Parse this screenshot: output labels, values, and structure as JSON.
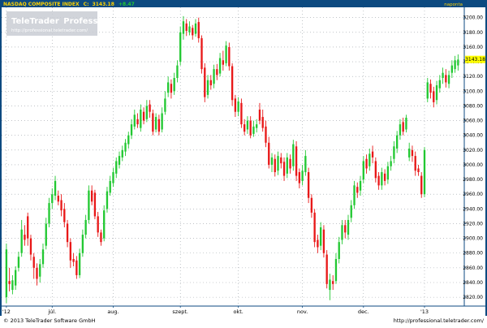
{
  "header": {
    "instrument": "NASDAQ COMPOSITE INDEX",
    "close_label": "C:",
    "close_value": "3143.18",
    "change": "+8.47",
    "interval": "napontа"
  },
  "watermark": {
    "brand_a": "TeleTrader",
    "brand_b": "Professional",
    "url": "http://professional.teletrader.com/"
  },
  "footer": {
    "copyright": "© 2013 TeleTrader Software GmbH",
    "url": "http://professional.teletrader.com/"
  },
  "colors": {
    "frame": "#0d4a80",
    "header_bg": "#0d4a80",
    "header_text": "#ffd200",
    "up": "#22c832",
    "down": "#e81818",
    "grid": "#9aa0a6",
    "price_tag_bg": "#ffff00"
  },
  "chart_data": {
    "type": "candlestick",
    "ylim": [
      2808,
      3214
    ],
    "yticks": [
      2820,
      2840,
      2860,
      2880,
      2900,
      2920,
      2940,
      2960,
      2980,
      3000,
      3020,
      3040,
      3060,
      3080,
      3100,
      3120,
      3140,
      3160,
      3180,
      3200
    ],
    "ytick_labels": [
      "2820.00",
      "2840.00",
      "2860.00",
      "2880.00",
      "2900.00",
      "2920.00",
      "2940.00",
      "2960.00",
      "2980.00",
      "3000.00",
      "3020.00",
      "3040.00",
      "3060.00",
      "3080.00",
      "3100.00",
      "3120.00",
      "3140.00",
      "3160.00",
      "3180.00",
      "3200.00"
    ],
    "last_price": 3143.18,
    "last_price_label": "3143.18",
    "x_count": 150,
    "xticks": [
      {
        "index": 0,
        "label": "'12"
      },
      {
        "index": 15,
        "label": "júl."
      },
      {
        "index": 35,
        "label": "aug."
      },
      {
        "index": 57,
        "label": "szept."
      },
      {
        "index": 76,
        "label": "okt."
      },
      {
        "index": 97,
        "label": "nov."
      },
      {
        "index": 117,
        "label": "dec."
      },
      {
        "index": 137,
        "label": "'13"
      }
    ],
    "candles": [
      {
        "o": 2820,
        "c": 2885,
        "h": 2893,
        "l": 2812
      },
      {
        "o": 2842,
        "c": 2838,
        "h": 2860,
        "l": 2828
      },
      {
        "o": 2830,
        "c": 2843,
        "h": 2850,
        "l": 2824
      },
      {
        "o": 2836,
        "c": 2857,
        "h": 2862,
        "l": 2830
      },
      {
        "o": 2860,
        "c": 2875,
        "h": 2882,
        "l": 2855
      },
      {
        "o": 2880,
        "c": 2912,
        "h": 2925,
        "l": 2875
      },
      {
        "o": 2905,
        "c": 2898,
        "h": 2918,
        "l": 2890
      },
      {
        "o": 2930,
        "c": 2900,
        "h": 2935,
        "l": 2890
      },
      {
        "o": 2900,
        "c": 2878,
        "h": 2905,
        "l": 2870
      },
      {
        "o": 2875,
        "c": 2860,
        "h": 2880,
        "l": 2845
      },
      {
        "o": 2860,
        "c": 2845,
        "h": 2866,
        "l": 2836
      },
      {
        "o": 2848,
        "c": 2865,
        "h": 2872,
        "l": 2840
      },
      {
        "o": 2865,
        "c": 2885,
        "h": 2893,
        "l": 2860
      },
      {
        "o": 2890,
        "c": 2920,
        "h": 2928,
        "l": 2885
      },
      {
        "o": 2920,
        "c": 2948,
        "h": 2955,
        "l": 2915
      },
      {
        "o": 2948,
        "c": 2960,
        "h": 2968,
        "l": 2940
      },
      {
        "o": 2958,
        "c": 2978,
        "h": 2985,
        "l": 2952
      },
      {
        "o": 2958,
        "c": 2950,
        "h": 2965,
        "l": 2945
      },
      {
        "o": 2952,
        "c": 2938,
        "h": 2960,
        "l": 2930
      },
      {
        "o": 2940,
        "c": 2922,
        "h": 2948,
        "l": 2915
      },
      {
        "o": 2920,
        "c": 2895,
        "h": 2925,
        "l": 2888
      },
      {
        "o": 2895,
        "c": 2870,
        "h": 2900,
        "l": 2860
      },
      {
        "o": 2872,
        "c": 2868,
        "h": 2880,
        "l": 2862
      },
      {
        "o": 2870,
        "c": 2850,
        "h": 2876,
        "l": 2845
      },
      {
        "o": 2850,
        "c": 2880,
        "h": 2886,
        "l": 2846
      },
      {
        "o": 2880,
        "c": 2905,
        "h": 2912,
        "l": 2875
      },
      {
        "o": 2905,
        "c": 2925,
        "h": 2932,
        "l": 2900
      },
      {
        "o": 2925,
        "c": 2965,
        "h": 2972,
        "l": 2920
      },
      {
        "o": 2965,
        "c": 2950,
        "h": 2972,
        "l": 2945
      },
      {
        "o": 2962,
        "c": 2930,
        "h": 2966,
        "l": 2926
      },
      {
        "o": 2930,
        "c": 2908,
        "h": 2936,
        "l": 2902
      },
      {
        "o": 2908,
        "c": 2895,
        "h": 2912,
        "l": 2890
      },
      {
        "o": 2900,
        "c": 2938,
        "h": 2945,
        "l": 2896
      },
      {
        "o": 2940,
        "c": 2964,
        "h": 2970,
        "l": 2935
      },
      {
        "o": 2962,
        "c": 2978,
        "h": 2985,
        "l": 2958
      },
      {
        "o": 2975,
        "c": 2990,
        "h": 2996,
        "l": 2970
      },
      {
        "o": 2988,
        "c": 3005,
        "h": 3010,
        "l": 2982
      },
      {
        "o": 3000,
        "c": 3012,
        "h": 3018,
        "l": 2995
      },
      {
        "o": 3010,
        "c": 3020,
        "h": 3026,
        "l": 3005
      },
      {
        "o": 3018,
        "c": 3030,
        "h": 3035,
        "l": 3012
      },
      {
        "o": 3028,
        "c": 3040,
        "h": 3045,
        "l": 3022
      },
      {
        "o": 3040,
        "c": 3055,
        "h": 3062,
        "l": 3035
      },
      {
        "o": 3052,
        "c": 3068,
        "h": 3075,
        "l": 3048
      },
      {
        "o": 3062,
        "c": 3055,
        "h": 3070,
        "l": 3050
      },
      {
        "o": 3050,
        "c": 3075,
        "h": 3082,
        "l": 3045
      },
      {
        "o": 3072,
        "c": 3060,
        "h": 3078,
        "l": 3055
      },
      {
        "o": 3062,
        "c": 3080,
        "h": 3088,
        "l": 3058
      },
      {
        "o": 3082,
        "c": 3072,
        "h": 3088,
        "l": 3064
      },
      {
        "o": 3070,
        "c": 3045,
        "h": 3075,
        "l": 3040
      },
      {
        "o": 3048,
        "c": 3065,
        "h": 3070,
        "l": 3044
      },
      {
        "o": 3062,
        "c": 3045,
        "h": 3068,
        "l": 3040
      },
      {
        "o": 3048,
        "c": 3070,
        "h": 3078,
        "l": 3044
      },
      {
        "o": 3072,
        "c": 3090,
        "h": 3100,
        "l": 3068
      },
      {
        "o": 3098,
        "c": 3112,
        "h": 3120,
        "l": 3092
      },
      {
        "o": 3110,
        "c": 3098,
        "h": 3116,
        "l": 3090
      },
      {
        "o": 3100,
        "c": 3118,
        "h": 3125,
        "l": 3095
      },
      {
        "o": 3118,
        "c": 3135,
        "h": 3142,
        "l": 3112
      },
      {
        "o": 3140,
        "c": 3180,
        "h": 3188,
        "l": 3135
      },
      {
        "o": 3178,
        "c": 3195,
        "h": 3202,
        "l": 3170
      },
      {
        "o": 3192,
        "c": 3182,
        "h": 3198,
        "l": 3175
      },
      {
        "o": 3180,
        "c": 3188,
        "h": 3195,
        "l": 3176
      },
      {
        "o": 3186,
        "c": 3176,
        "h": 3190,
        "l": 3170
      },
      {
        "o": 3178,
        "c": 3192,
        "h": 3198,
        "l": 3174
      },
      {
        "o": 3194,
        "c": 3172,
        "h": 3200,
        "l": 3166
      },
      {
        "o": 3172,
        "c": 3130,
        "h": 3176,
        "l": 3124
      },
      {
        "o": 3132,
        "c": 3092,
        "h": 3138,
        "l": 3085
      },
      {
        "o": 3095,
        "c": 3115,
        "h": 3122,
        "l": 3090
      },
      {
        "o": 3115,
        "c": 3108,
        "h": 3122,
        "l": 3102
      },
      {
        "o": 3110,
        "c": 3130,
        "h": 3136,
        "l": 3104
      },
      {
        "o": 3130,
        "c": 3122,
        "h": 3137,
        "l": 3115
      },
      {
        "o": 3124,
        "c": 3145,
        "h": 3152,
        "l": 3120
      },
      {
        "o": 3142,
        "c": 3136,
        "h": 3155,
        "l": 3128
      },
      {
        "o": 3138,
        "c": 3162,
        "h": 3168,
        "l": 3134
      },
      {
        "o": 3160,
        "c": 3134,
        "h": 3166,
        "l": 3128
      },
      {
        "o": 3134,
        "c": 3088,
        "h": 3138,
        "l": 3080
      },
      {
        "o": 3090,
        "c": 3072,
        "h": 3095,
        "l": 3065
      },
      {
        "o": 3072,
        "c": 3086,
        "h": 3092,
        "l": 3066
      },
      {
        "o": 3084,
        "c": 3055,
        "h": 3090,
        "l": 3050
      },
      {
        "o": 3055,
        "c": 3045,
        "h": 3062,
        "l": 3040
      },
      {
        "o": 3048,
        "c": 3060,
        "h": 3066,
        "l": 3042
      },
      {
        "o": 3060,
        "c": 3040,
        "h": 3066,
        "l": 3036
      },
      {
        "o": 3042,
        "c": 3052,
        "h": 3060,
        "l": 3038
      },
      {
        "o": 3050,
        "c": 3055,
        "h": 3062,
        "l": 3044
      },
      {
        "o": 3075,
        "c": 3060,
        "h": 3084,
        "l": 3055
      },
      {
        "o": 3065,
        "c": 3050,
        "h": 3075,
        "l": 3045
      },
      {
        "o": 3052,
        "c": 3030,
        "h": 3060,
        "l": 3024
      },
      {
        "o": 3030,
        "c": 3000,
        "h": 3038,
        "l": 2995
      },
      {
        "o": 3000,
        "c": 3010,
        "h": 3016,
        "l": 2990
      },
      {
        "o": 3008,
        "c": 2990,
        "h": 3014,
        "l": 2984
      },
      {
        "o": 2992,
        "c": 3012,
        "h": 3018,
        "l": 2986
      },
      {
        "o": 3010,
        "c": 3002,
        "h": 3016,
        "l": 2995
      },
      {
        "o": 3004,
        "c": 2985,
        "h": 3010,
        "l": 2978
      },
      {
        "o": 2988,
        "c": 3010,
        "h": 3016,
        "l": 2982
      },
      {
        "o": 3008,
        "c": 2995,
        "h": 3014,
        "l": 2988
      },
      {
        "o": 2998,
        "c": 3028,
        "h": 3034,
        "l": 2992
      },
      {
        "o": 3025,
        "c": 2985,
        "h": 3032,
        "l": 2978
      },
      {
        "o": 2990,
        "c": 2975,
        "h": 2995,
        "l": 2968
      },
      {
        "o": 2978,
        "c": 2992,
        "h": 3000,
        "l": 2972
      },
      {
        "o": 2990,
        "c": 3012,
        "h": 3020,
        "l": 2985
      },
      {
        "o": 2990,
        "c": 2955,
        "h": 2996,
        "l": 2948
      },
      {
        "o": 2955,
        "c": 2935,
        "h": 2960,
        "l": 2928
      },
      {
        "o": 2935,
        "c": 2895,
        "h": 2940,
        "l": 2888
      },
      {
        "o": 2898,
        "c": 2888,
        "h": 2905,
        "l": 2880
      },
      {
        "o": 2890,
        "c": 2915,
        "h": 2922,
        "l": 2884
      },
      {
        "o": 2912,
        "c": 2880,
        "h": 2918,
        "l": 2874
      },
      {
        "o": 2878,
        "c": 2838,
        "h": 2884,
        "l": 2832
      },
      {
        "o": 2830,
        "c": 2844,
        "h": 2852,
        "l": 2816
      },
      {
        "o": 2842,
        "c": 2838,
        "h": 2850,
        "l": 2830
      },
      {
        "o": 2842,
        "c": 2872,
        "h": 2880,
        "l": 2838
      },
      {
        "o": 2872,
        "c": 2895,
        "h": 2902,
        "l": 2866
      },
      {
        "o": 2898,
        "c": 2918,
        "h": 2925,
        "l": 2892
      },
      {
        "o": 2918,
        "c": 2908,
        "h": 2925,
        "l": 2900
      },
      {
        "o": 2905,
        "c": 2925,
        "h": 2932,
        "l": 2898
      },
      {
        "o": 2928,
        "c": 2945,
        "h": 2952,
        "l": 2922
      },
      {
        "o": 2945,
        "c": 2972,
        "h": 2978,
        "l": 2940
      },
      {
        "o": 2970,
        "c": 2962,
        "h": 2976,
        "l": 2955
      },
      {
        "o": 2965,
        "c": 2978,
        "h": 2985,
        "l": 2958
      },
      {
        "o": 2980,
        "c": 3005,
        "h": 3012,
        "l": 2975
      },
      {
        "o": 3008,
        "c": 2995,
        "h": 3014,
        "l": 2988
      },
      {
        "o": 2998,
        "c": 3015,
        "h": 3022,
        "l": 2992
      },
      {
        "o": 3018,
        "c": 3010,
        "h": 3026,
        "l": 3002
      },
      {
        "o": 3005,
        "c": 2982,
        "h": 3010,
        "l": 2976
      },
      {
        "o": 2985,
        "c": 2972,
        "h": 2990,
        "l": 2966
      },
      {
        "o": 2972,
        "c": 2990,
        "h": 2996,
        "l": 2966
      },
      {
        "o": 2988,
        "c": 2978,
        "h": 2994,
        "l": 2972
      },
      {
        "o": 2980,
        "c": 2998,
        "h": 3004,
        "l": 2974
      },
      {
        "o": 2998,
        "c": 3005,
        "h": 3012,
        "l": 2992
      },
      {
        "o": 3008,
        "c": 3025,
        "h": 3032,
        "l": 3002
      },
      {
        "o": 3022,
        "c": 3040,
        "h": 3046,
        "l": 3016
      },
      {
        "o": 3040,
        "c": 3055,
        "h": 3062,
        "l": 3034
      },
      {
        "o": 3058,
        "c": 3045,
        "h": 3064,
        "l": 3040
      },
      {
        "o": 3048,
        "c": 3064,
        "h": 3068,
        "l": 3044
      },
      {
        "o": 3010,
        "c": 3022,
        "h": 3030,
        "l": 3005
      },
      {
        "o": 3020,
        "c": 3012,
        "h": 3026,
        "l": 3004
      },
      {
        "o": 3012,
        "c": 2992,
        "h": 3018,
        "l": 2985
      },
      {
        "o": 2995,
        "c": 2990,
        "h": 3000,
        "l": 2985
      },
      {
        "o": 2985,
        "c": 2960,
        "h": 2990,
        "l": 2955
      },
      {
        "o": 2960,
        "c": 3020,
        "h": 3024,
        "l": 2956
      },
      {
        "o": 3090,
        "c": 3112,
        "h": 3118,
        "l": 3085
      },
      {
        "o": 3110,
        "c": 3098,
        "h": 3116,
        "l": 3090
      },
      {
        "o": 3100,
        "c": 3085,
        "h": 3106,
        "l": 3078
      },
      {
        "o": 3088,
        "c": 3108,
        "h": 3114,
        "l": 3082
      },
      {
        "o": 3104,
        "c": 3115,
        "h": 3122,
        "l": 3098
      },
      {
        "o": 3118,
        "c": 3125,
        "h": 3132,
        "l": 3110
      },
      {
        "o": 3122,
        "c": 3112,
        "h": 3130,
        "l": 3105
      },
      {
        "o": 3110,
        "c": 3122,
        "h": 3128,
        "l": 3104
      },
      {
        "o": 3125,
        "c": 3135,
        "h": 3142,
        "l": 3118
      },
      {
        "o": 3130,
        "c": 3142,
        "h": 3148,
        "l": 3125
      },
      {
        "o": 3135,
        "c": 3143,
        "h": 3150,
        "l": 3128
      }
    ]
  }
}
